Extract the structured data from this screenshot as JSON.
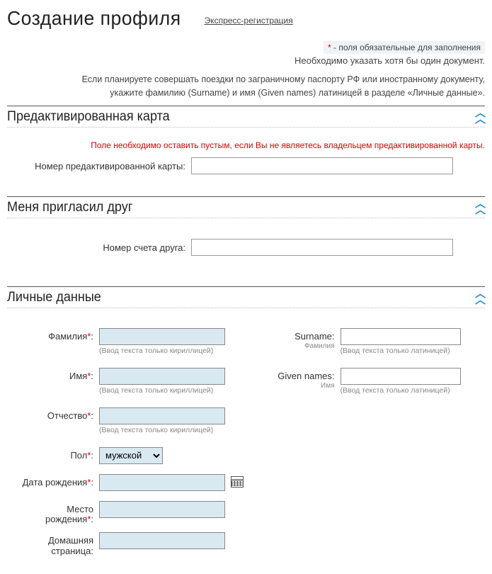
{
  "header": {
    "title": "Создание профиля",
    "express_link": "Экспресс-регистрация"
  },
  "notes": {
    "required_marker": "*",
    "required_text": " - поля обязательные для заполнения",
    "doc_required": "Необходимо указать хотя бы один документ.",
    "latin_note_l1": "Если планируете совершать поездки по заграничному паспорту РФ или иностранному документу,",
    "latin_note_l2": "укажите фамилию (Surname) и имя (Given names) латиницей в разделе «Личные данные»."
  },
  "section_preactivated": {
    "title": "Предактивированная карта",
    "hint": "Поле необходимо оставить пустым, если Вы не являетесь владельцем предактивированной карты.",
    "label": "Номер предактивированной карты:"
  },
  "section_friend": {
    "title": "Меня пригласил друг",
    "label": "Номер счета друга:"
  },
  "section_personal": {
    "title": "Личные данные",
    "hints": {
      "cyr": "(Ввод текста только кириллицей)",
      "lat": "(Ввод текста только латиницей)"
    },
    "left": {
      "surname": "Фамилия",
      "name": "Имя",
      "patronymic": "Отчество",
      "gender": "Пол",
      "gender_value": "мужской",
      "dob": "Дата рождения",
      "pob_l1": "Место",
      "pob_l2": "рождения",
      "homepage_l1": "Домашняя",
      "homepage_l2": "страница"
    },
    "right": {
      "surname": "Surname:",
      "surname_sub": "Фамилия",
      "given": "Given names:",
      "given_sub": "Имя"
    },
    "colon": ":",
    "star": "*"
  }
}
